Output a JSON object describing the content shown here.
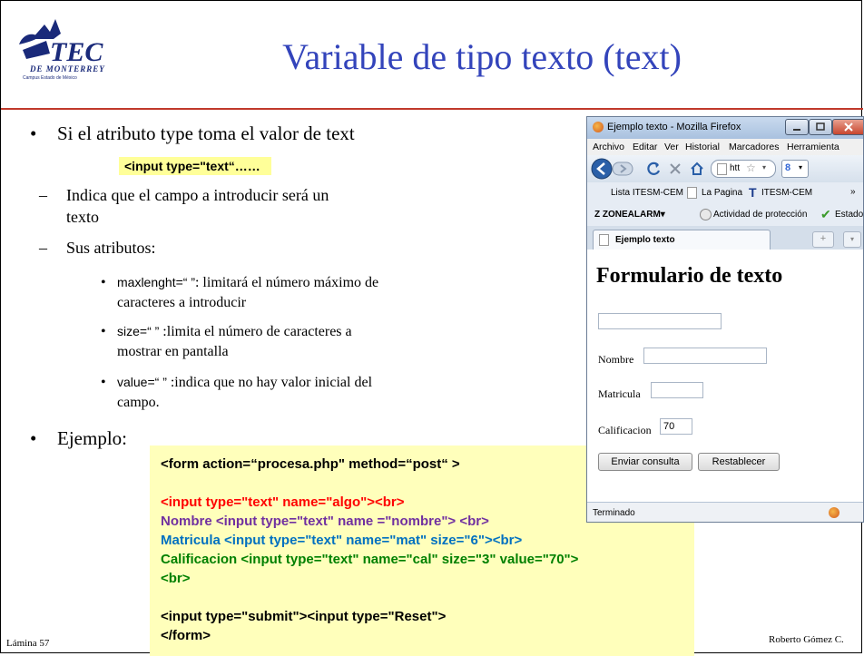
{
  "slide": {
    "title": "Variable de tipo texto (text)",
    "logo_text": "TEC",
    "logo_subtext": "DE MONTERREY",
    "logo_caption": "Campus Estado de México",
    "bullet1": "Si el atributo type toma el valor de text",
    "code_inline": "<input type=\"text“……",
    "sub1_line1": "Indica que el campo a introducir será un",
    "sub1_line2": "texto",
    "sub2": "Sus atributos:",
    "attr1_line1_sans": "maxlenght=“ ”",
    "attr1_line1_rest": ": limitará el número máximo de",
    "attr1_line2": "caracteres a introducir",
    "attr2_line1_sans": "size=“ ”",
    "attr2_line1_rest": " :limita el número de caracteres a",
    "attr2_line2": "mostrar en pantalla",
    "attr3_line1_sans": "value=“ ”",
    "attr3_line1_rest": " :indica que no hay valor inicial del",
    "attr3_line2": "campo.",
    "bullet2": "Ejemplo:",
    "dash": "–",
    "bullet_char": "•",
    "small_bullet": "•"
  },
  "code_block": {
    "line1": "<form  action=“procesa.php\"   method=“post“ >",
    "line2": "<input type=\"text\" name=\"algo\"><br>",
    "line3": "Nombre <input type=\"text\" name =\"nombre\"> <br>",
    "line4": "Matricula <input type=\"text\" name=\"mat\" size=\"6\"><br>",
    "line5": "Calificacion <input type=\"text\" name=\"cal\" size=\"3\" value=\"70\">",
    "line6": "<br>",
    "line7": "<input type=\"submit\"><input type=\"Reset\">",
    "line8": "</form>",
    "colors": {
      "black": "#000000",
      "red": "#ff0000",
      "purple": "#7030a0",
      "blue": "#0070c0",
      "green": "#008000"
    }
  },
  "browser": {
    "window_title": "Ejemplo texto - Mozilla Firefox",
    "menu": [
      "Archivo",
      "Editar",
      "Ver",
      "Historial",
      "Marcadores",
      "Herramienta"
    ],
    "url_text": "htt",
    "bookmarks": [
      "Lista ITESM-CEM",
      "La Pagina",
      "ITESM-CEM"
    ],
    "bookmarks_more": "»",
    "zonealarm": "ZONEALARM",
    "zone_items": [
      "Actividad de protección",
      "Estado"
    ],
    "tab_label": "Ejemplo texto",
    "tab_plus": "+",
    "page_heading": "Formulario de texto",
    "label_nombre": "Nombre",
    "label_matricula": "Matricula",
    "label_calificacion": "Calificacion",
    "calificacion_value": "70",
    "submit_label": "Enviar consulta",
    "reset_label": "Restablecer",
    "status_text": "Terminado"
  },
  "footer": {
    "left": "Lámina 57",
    "right": "Roberto Gómez C."
  },
  "colors": {
    "title": "#3344bb",
    "rule": "#c0392b",
    "highlight": "#ffff99",
    "code_bg": "#ffffbb"
  }
}
